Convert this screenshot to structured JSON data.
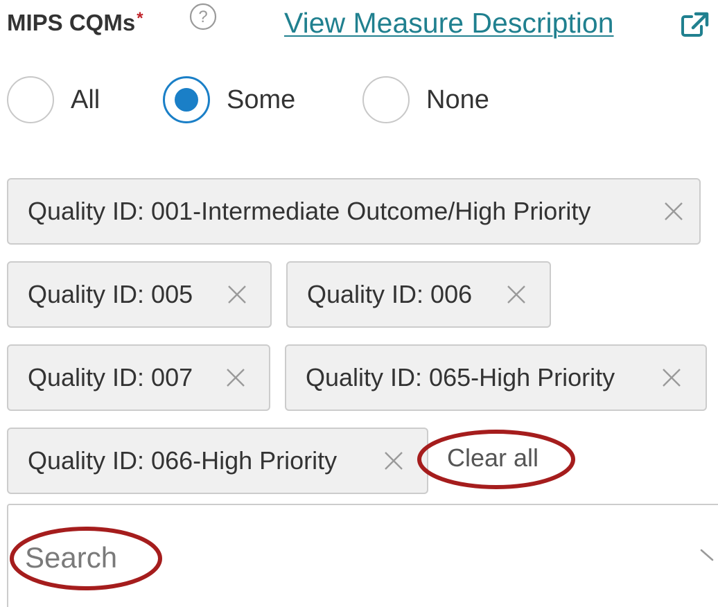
{
  "field": {
    "label": "MIPS CQMs",
    "required_mark": "*",
    "help_icon": "question-circle-icon",
    "link_text": "View Measure Description",
    "link_icon": "external-link-icon"
  },
  "radios": [
    {
      "label": "All",
      "checked": false
    },
    {
      "label": "Some",
      "checked": true
    },
    {
      "label": "None",
      "checked": false
    }
  ],
  "chips": [
    {
      "label": "Quality ID: 001-Intermediate Outcome/High Priority"
    },
    {
      "label": "Quality ID: 005"
    },
    {
      "label": "Quality ID: 006"
    },
    {
      "label": "Quality ID: 007"
    },
    {
      "label": "Quality ID: 065-High Priority"
    },
    {
      "label": "Quality ID: 066-High Priority"
    }
  ],
  "chip_remove_icon": "close-x-icon",
  "clear_all_label": "Clear all",
  "search": {
    "placeholder": "Search",
    "dropdown_icon": "chevron-down-icon"
  },
  "colors": {
    "link": "#20808f",
    "radio_selected": "#1a7fc7",
    "required": "#c0232a",
    "annotation": "#a51d1d",
    "chip_bg": "#f0f0f0",
    "chip_border": "#cccccc"
  }
}
